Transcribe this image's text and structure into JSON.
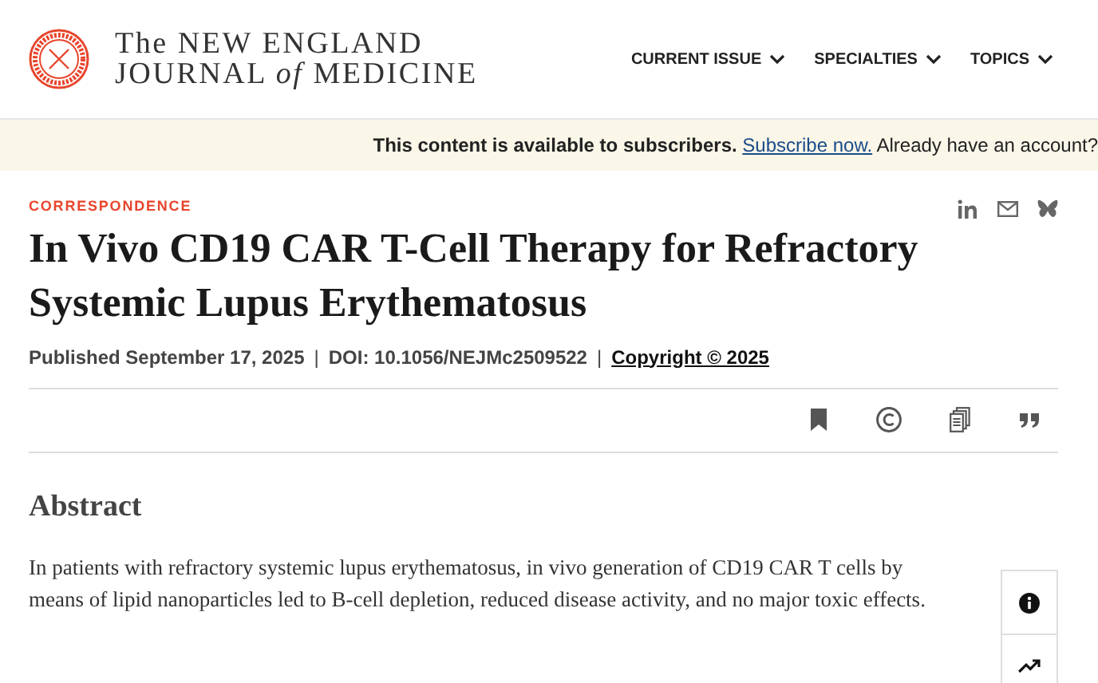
{
  "logo": {
    "line_1": "The NEW ENGLAND",
    "line_2": "JOURNAL *of* MEDICINE"
  },
  "nav": [
    {
      "label": "CURRENT ISSUE"
    },
    {
      "label": "SPECIALTIES"
    },
    {
      "label": "TOPICS"
    }
  ],
  "banner": {
    "notice": "This content is available to subscribers.",
    "link": "Subscribe now.",
    "rest": "Already have an account?"
  },
  "article": {
    "category": "CORRESPONDENCE",
    "title": "In Vivo CD19 CAR T-Cell Therapy for Refractory Systemic Lupus Erythematosus",
    "published": "Published September 17, 2025",
    "doi": "DOI: 10.1056/NEJMc2509522",
    "copyright": "Copyright © 2025",
    "separator": "|"
  },
  "share": [
    {
      "kind": "linkedin"
    },
    {
      "kind": "email"
    },
    {
      "kind": "butterfly"
    }
  ],
  "tools": [
    {
      "kind": "bookmark"
    },
    {
      "kind": "copyright"
    },
    {
      "kind": "pages"
    },
    {
      "kind": "quote"
    }
  ],
  "abstract": {
    "heading": "Abstract",
    "text": "In patients with refractory systemic lupus erythematosus, in vivo generation of CD19 CAR T cells by means of lipid nanoparticles led to B-cell depletion, reduced disease activity, and no major toxic effects."
  },
  "side_panel": [
    {
      "kind": "info"
    },
    {
      "kind": "trend"
    }
  ]
}
